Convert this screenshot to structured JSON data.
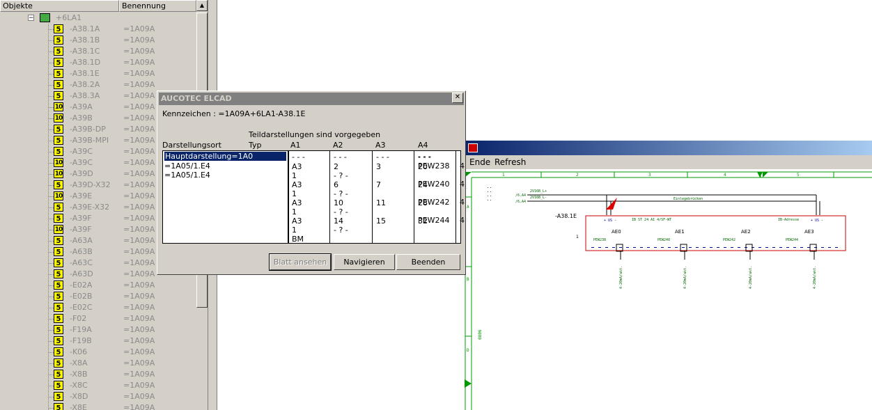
{
  "tree": {
    "header_objekte": "Objekte",
    "header_benennung": "Benennung",
    "root": {
      "name": "+6LA1"
    },
    "rows": [
      {
        "icon": "5",
        "name": "-A38.1A",
        "ben": "=1A09A"
      },
      {
        "icon": "5",
        "name": "-A38.1B",
        "ben": "=1A09A"
      },
      {
        "icon": "5",
        "name": "-A38.1C",
        "ben": "=1A09A"
      },
      {
        "icon": "5",
        "name": "-A38.1D",
        "ben": "=1A09A"
      },
      {
        "icon": "5",
        "name": "-A38.1E",
        "ben": "=1A09A"
      },
      {
        "icon": "5",
        "name": "-A38.2A",
        "ben": "=1A09A"
      },
      {
        "icon": "5",
        "name": "-A38.3A",
        "ben": "=1A09A"
      },
      {
        "icon": "10",
        "name": "-A39A",
        "ben": "=1A09A"
      },
      {
        "icon": "10",
        "name": "-A39B",
        "ben": "=1A09A"
      },
      {
        "icon": "5",
        "name": "-A39B-DP",
        "ben": "=1A09A"
      },
      {
        "icon": "5",
        "name": "-A39B-MPI",
        "ben": "=1A09A"
      },
      {
        "icon": "5",
        "name": "-A39C",
        "ben": "=1A09A"
      },
      {
        "icon": "10",
        "name": "-A39C",
        "ben": "=1A09A"
      },
      {
        "icon": "10",
        "name": "-A39D",
        "ben": "=1A09A"
      },
      {
        "icon": "5",
        "name": "-A39D-X32",
        "ben": "=1A09A"
      },
      {
        "icon": "10",
        "name": "-A39E",
        "ben": "=1A09A"
      },
      {
        "icon": "5",
        "name": "-A39E-X32",
        "ben": "=1A09A"
      },
      {
        "icon": "5",
        "name": "-A39F",
        "ben": "=1A09A"
      },
      {
        "icon": "10",
        "name": "-A39F",
        "ben": "=1A09A"
      },
      {
        "icon": "5",
        "name": "-A63A",
        "ben": "=1A09A"
      },
      {
        "icon": "5",
        "name": "-A63B",
        "ben": "=1A09A"
      },
      {
        "icon": "5",
        "name": "-A63C",
        "ben": "=1A09A"
      },
      {
        "icon": "5",
        "name": "-A63D",
        "ben": "=1A09A"
      },
      {
        "icon": "5",
        "name": "-E02A",
        "ben": "=1A09A"
      },
      {
        "icon": "5",
        "name": "-E02B",
        "ben": "=1A09A"
      },
      {
        "icon": "5",
        "name": "-E02C",
        "ben": "=1A09A"
      },
      {
        "icon": "5",
        "name": "-F02",
        "ben": "=1A09A"
      },
      {
        "icon": "5",
        "name": "-F19A",
        "ben": "=1A09A"
      },
      {
        "icon": "5",
        "name": "-F19B",
        "ben": "=1A09A"
      },
      {
        "icon": "5",
        "name": "-K06",
        "ben": "=1A09A"
      },
      {
        "icon": "5",
        "name": "-X8A",
        "ben": "=1A09A"
      },
      {
        "icon": "5",
        "name": "-X8B",
        "ben": "=1A09A"
      },
      {
        "icon": "5",
        "name": "-X8C",
        "ben": "=1A09A"
      },
      {
        "icon": "5",
        "name": "-X8D",
        "ben": "=1A09A"
      },
      {
        "icon": "5",
        "name": "-X8E",
        "ben": "=1A09A"
      }
    ]
  },
  "dialog": {
    "title": "AUCOTEC ELCAD",
    "close": "✕",
    "kennzeichen": "Kennzeichen : =1A09A+6LA1-A38.1E",
    "teildarstellungen": "Teildarstellungen sind vorgegeben",
    "darstellungsort_label": "Darstellungsort",
    "columns": [
      "Typ",
      "A1",
      "A2",
      "A3",
      "A4"
    ],
    "locations": [
      "Hauptdarstellung=1A0",
      "=1A05/1.E4",
      "=1A05/1.E4"
    ],
    "typ": [
      "- - -",
      "A3",
      "1",
      "A3",
      "1",
      "A3",
      "1",
      "A3",
      "1",
      "BM"
    ],
    "a1": [
      "- - -",
      "2",
      "- ? -",
      "6",
      "- ? -",
      "10",
      "- ? -",
      "14",
      "- ? -"
    ],
    "a2": [
      "- - -",
      "3",
      "7",
      "11",
      "15"
    ],
    "a3": [
      "- - -",
      "20",
      "24",
      "28",
      "32"
    ],
    "a4": [
      "- - -",
      "PEW238",
      "PEW240",
      "PEW242",
      "PEW244"
    ],
    "overflow": [
      "4",
      "4",
      "4",
      "4"
    ],
    "buttons": {
      "blatt": "Blatt ansehen",
      "navigieren": "Navigieren",
      "beenden": "Beenden"
    }
  },
  "viewer": {
    "menu": {
      "ende": "Ende",
      "refresh": "Refresh"
    },
    "ruler_numbers": [
      "1",
      "2",
      "3",
      "4",
      "5"
    ],
    "row_letters": [
      "A",
      "B",
      "C",
      "D"
    ],
    "device": "-A38.1E",
    "wire_refs": [
      "/6.A4",
      "/6.A4"
    ],
    "wire_labels": [
      "2V16B_L+",
      "2V16B_L-"
    ],
    "einlegebruecken": "Einlegebrücken",
    "module_text": "IB ST 24 AI 4/SF-WT",
    "ib_adresse": "IB-Adresse",
    "us": [
      "+ US -",
      "+ US -"
    ],
    "channels": [
      "AE0",
      "AE1",
      "AE2",
      "AE3"
    ],
    "pews": [
      "PEW238",
      "PEW240",
      "PEW242",
      "PEW244"
    ],
    "row_one": "1",
    "sig": [
      "4-20mA/akt.",
      "4-20mA/akt.",
      "4-20mA/akt.",
      "4-20mA/akt."
    ],
    "side_tag": "0806"
  }
}
